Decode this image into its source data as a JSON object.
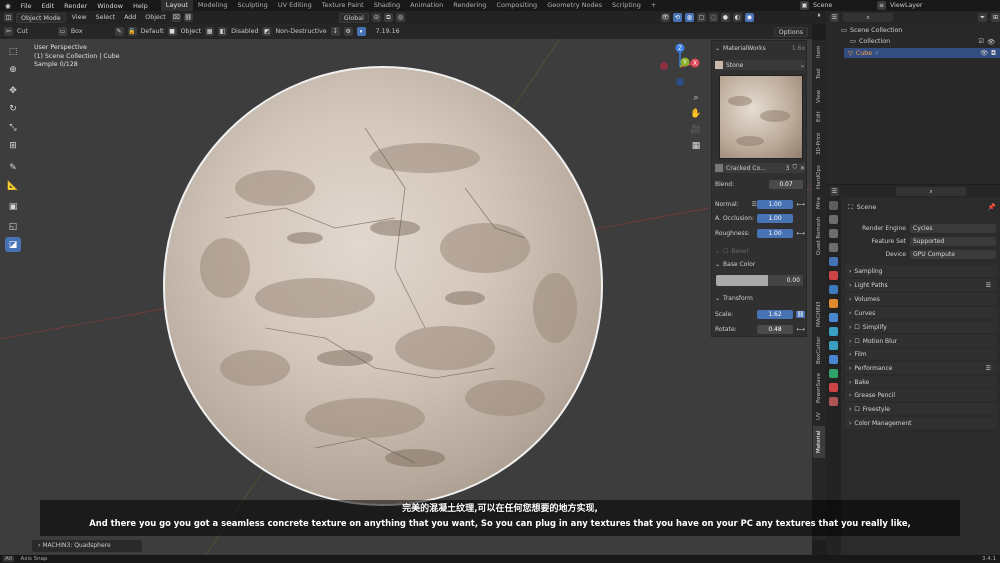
{
  "menubar": {
    "items": [
      "File",
      "Edit",
      "Render",
      "Window",
      "Help"
    ],
    "workspaces": [
      "Layout",
      "Modeling",
      "Sculpting",
      "UV Editing",
      "Texture Paint",
      "Shading",
      "Animation",
      "Rendering",
      "Compositing",
      "Geometry Nodes",
      "Scripting"
    ],
    "active_workspace": "Layout",
    "scene": "Scene",
    "view_layer": "ViewLayer"
  },
  "header": {
    "mode": "Object Mode",
    "menus": [
      "View",
      "Select",
      "Add",
      "Object"
    ],
    "orientation": "Global"
  },
  "toolbar": {
    "cut": "Cut",
    "box": "Box",
    "default": "Default",
    "object": "Object",
    "disabled": "Disabled",
    "non_destructive": "Non-Destructive",
    "version": "7.19.16",
    "options": "Options"
  },
  "viewport": {
    "line1": "User Perspective",
    "line2": "(1) Scene Collection | Cube",
    "line3": "Sample 0/128",
    "gizmo": {
      "x": "X",
      "y": "Y",
      "z": "Z"
    }
  },
  "materialworks": {
    "title": "MaterialWorks",
    "version": "1.6x",
    "material": "Stone",
    "texture": "Cracked Co...",
    "texture_users": "3",
    "blend_label": "Blend:",
    "blend": "0.07",
    "normal_label": "Normal:",
    "normal": "1.00",
    "ao_label": "A. Occlusion:",
    "ao": "1.00",
    "rough_label": "Roughness:",
    "rough": "1.00",
    "bevel": "Bevel",
    "base_color": "Base Color",
    "base_color_value": "0.00",
    "transform": "Transform",
    "scale_label": "Scale:",
    "scale": "1.62",
    "rotate_label": "Rotate:",
    "rotate": "0.48"
  },
  "side_tabs": [
    "Item",
    "Tool",
    "View",
    "Edit",
    "3D-Print",
    "HardOps",
    "Mira",
    "Quad Remesh",
    "MACHIN3",
    "BoxCutter",
    "PowerSave",
    "UV",
    "Material"
  ],
  "outliner": {
    "root": "Scene Collection",
    "collection": "Collection",
    "object": "Cube"
  },
  "properties": {
    "title": "Scene",
    "render_engine_label": "Render Engine",
    "render_engine": "Cycles",
    "feature_set_label": "Feature Set",
    "feature_set": "Supported",
    "device_label": "Device",
    "device": "GPU Compute",
    "sections": [
      "Sampling",
      "Light Paths",
      "Volumes",
      "Curves",
      "Simplify",
      "Motion Blur",
      "Film",
      "Performance",
      "Bake",
      "Grease Pencil",
      "Freestyle",
      "Color Management"
    ]
  },
  "subtitles": {
    "zh": "完美的混凝土纹理,可以在任何您想要的地方实现,",
    "en": "And there you go you got a seamless concrete texture on anything that you want, So you can plug in any textures that you have on your PC any textures that you really like,"
  },
  "footer": {
    "machin3": "MACHIN3: Quadsphere",
    "status_key": "Alt",
    "status": "Axis Snap",
    "version": "3.4.1"
  },
  "colors": {
    "accent": "#4772b3",
    "x_axis": "#e0485a",
    "y_axis": "#8ab32b",
    "z_axis": "#3c7fe0"
  }
}
